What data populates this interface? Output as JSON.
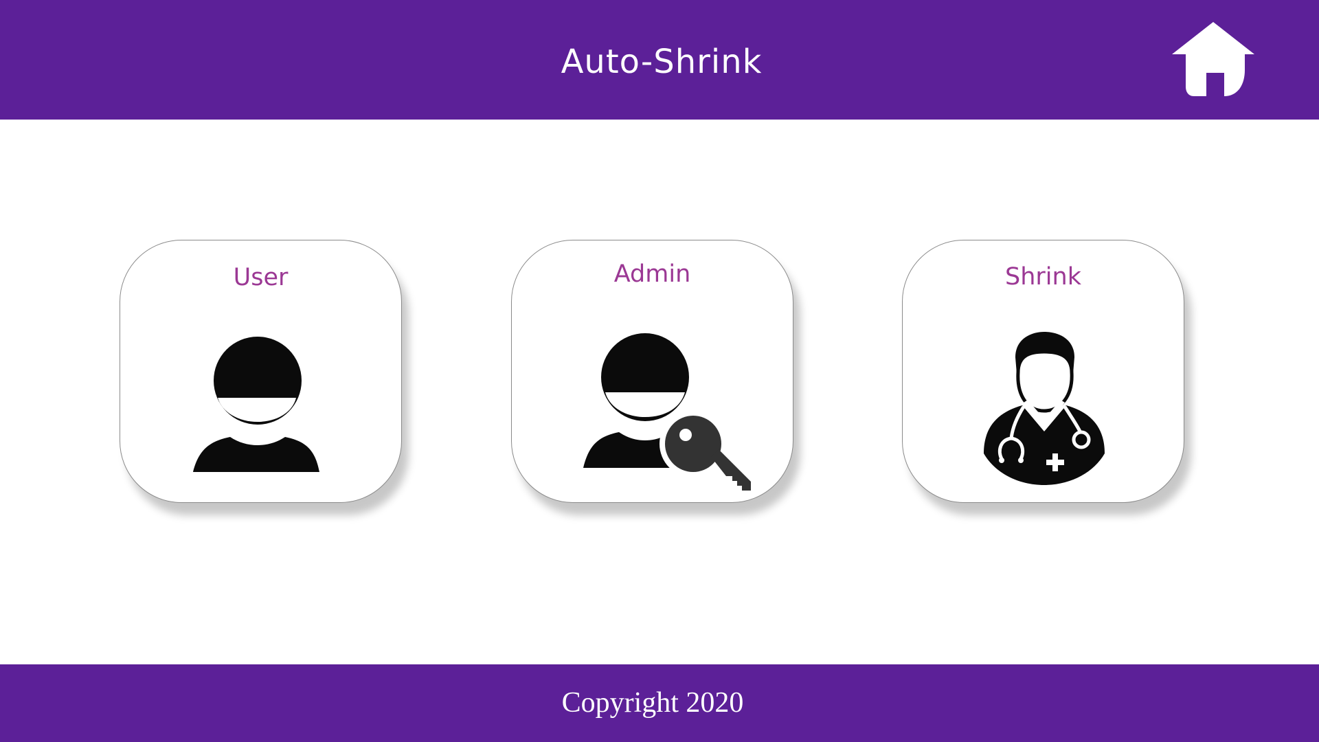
{
  "header": {
    "title": "Auto-Shrink",
    "home_icon": "home-icon",
    "background_color": "#5c2098",
    "title_color": "#ffffff"
  },
  "cards": [
    {
      "label": "User",
      "icon": "user-icon"
    },
    {
      "label": "Admin",
      "icon": "user-key-icon"
    },
    {
      "label": "Shrink",
      "icon": "doctor-icon"
    }
  ],
  "card_style": {
    "label_color": "#9b3894",
    "background_color": "#ffffff"
  },
  "footer": {
    "copyright": "Copyright 2020",
    "background_color": "#5c2098"
  }
}
